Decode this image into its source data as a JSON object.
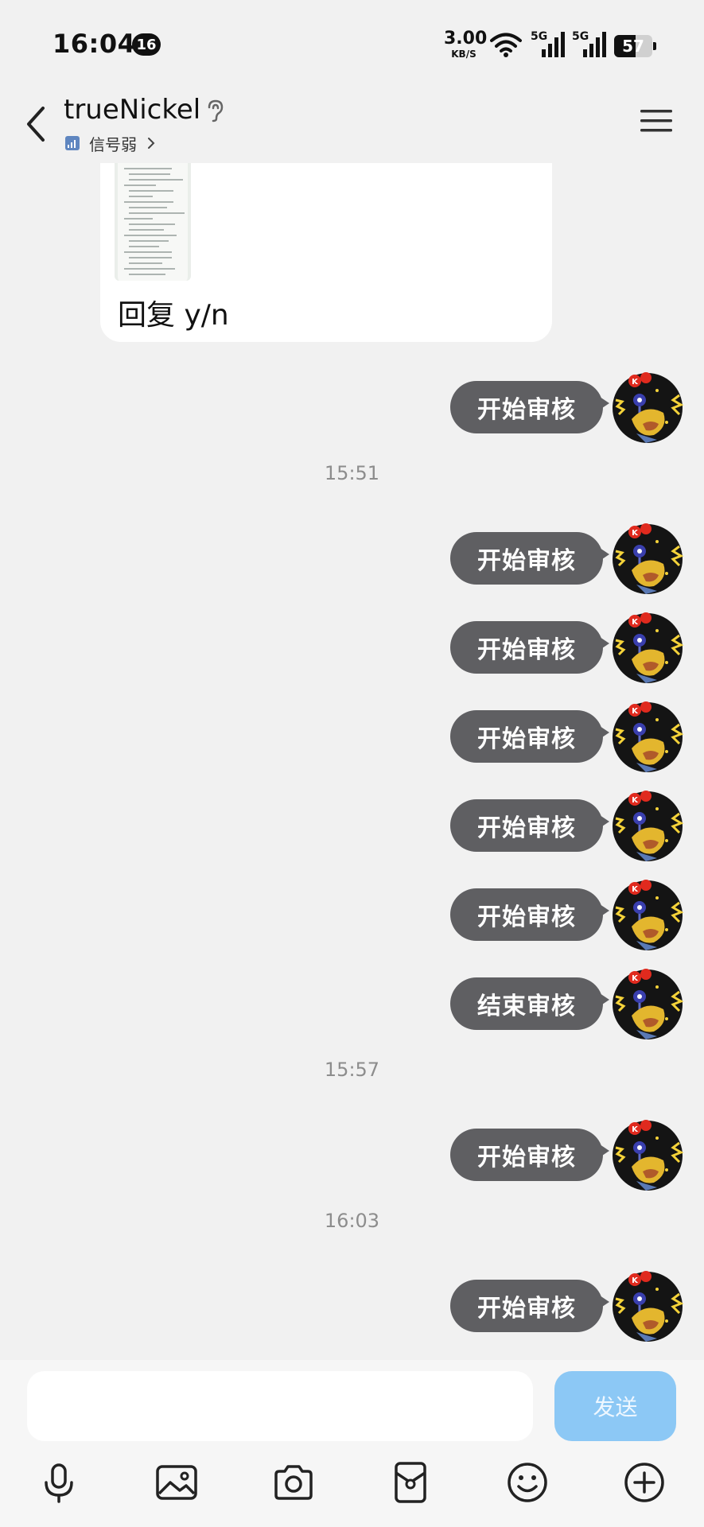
{
  "status_bar": {
    "time": "16:04",
    "notification_count": "16",
    "net_speed_value": "3.00",
    "net_speed_unit": "KB/S",
    "sim1_label": "5G",
    "sim2_label": "5G",
    "battery_level": "57",
    "battery_fraction": 0.57
  },
  "header": {
    "contact_name": "trueNickel",
    "signal_status": "信号弱"
  },
  "chat": {
    "incoming_reply_text": "回复 y/n",
    "messages": [
      {
        "text": "开始审核"
      },
      {
        "timestamp": "15:51"
      },
      {
        "text": "开始审核"
      },
      {
        "text": "开始审核"
      },
      {
        "text": "开始审核"
      },
      {
        "text": "开始审核"
      },
      {
        "text": "开始审核"
      },
      {
        "text": "结束审核"
      },
      {
        "timestamp": "15:57"
      },
      {
        "text": "开始审核"
      },
      {
        "timestamp": "16:03"
      },
      {
        "text": "开始审核"
      }
    ]
  },
  "input": {
    "value": "",
    "placeholder": "",
    "send_label": "发送"
  },
  "toolbar": {
    "icons": [
      "microphone-icon",
      "image-icon",
      "camera-icon",
      "red-packet-icon",
      "emoji-icon",
      "plus-icon"
    ]
  },
  "colors": {
    "background": "#f1f1f1",
    "outgoing_bubble": "#5f5f62",
    "send_button": "#8cc8f5"
  }
}
